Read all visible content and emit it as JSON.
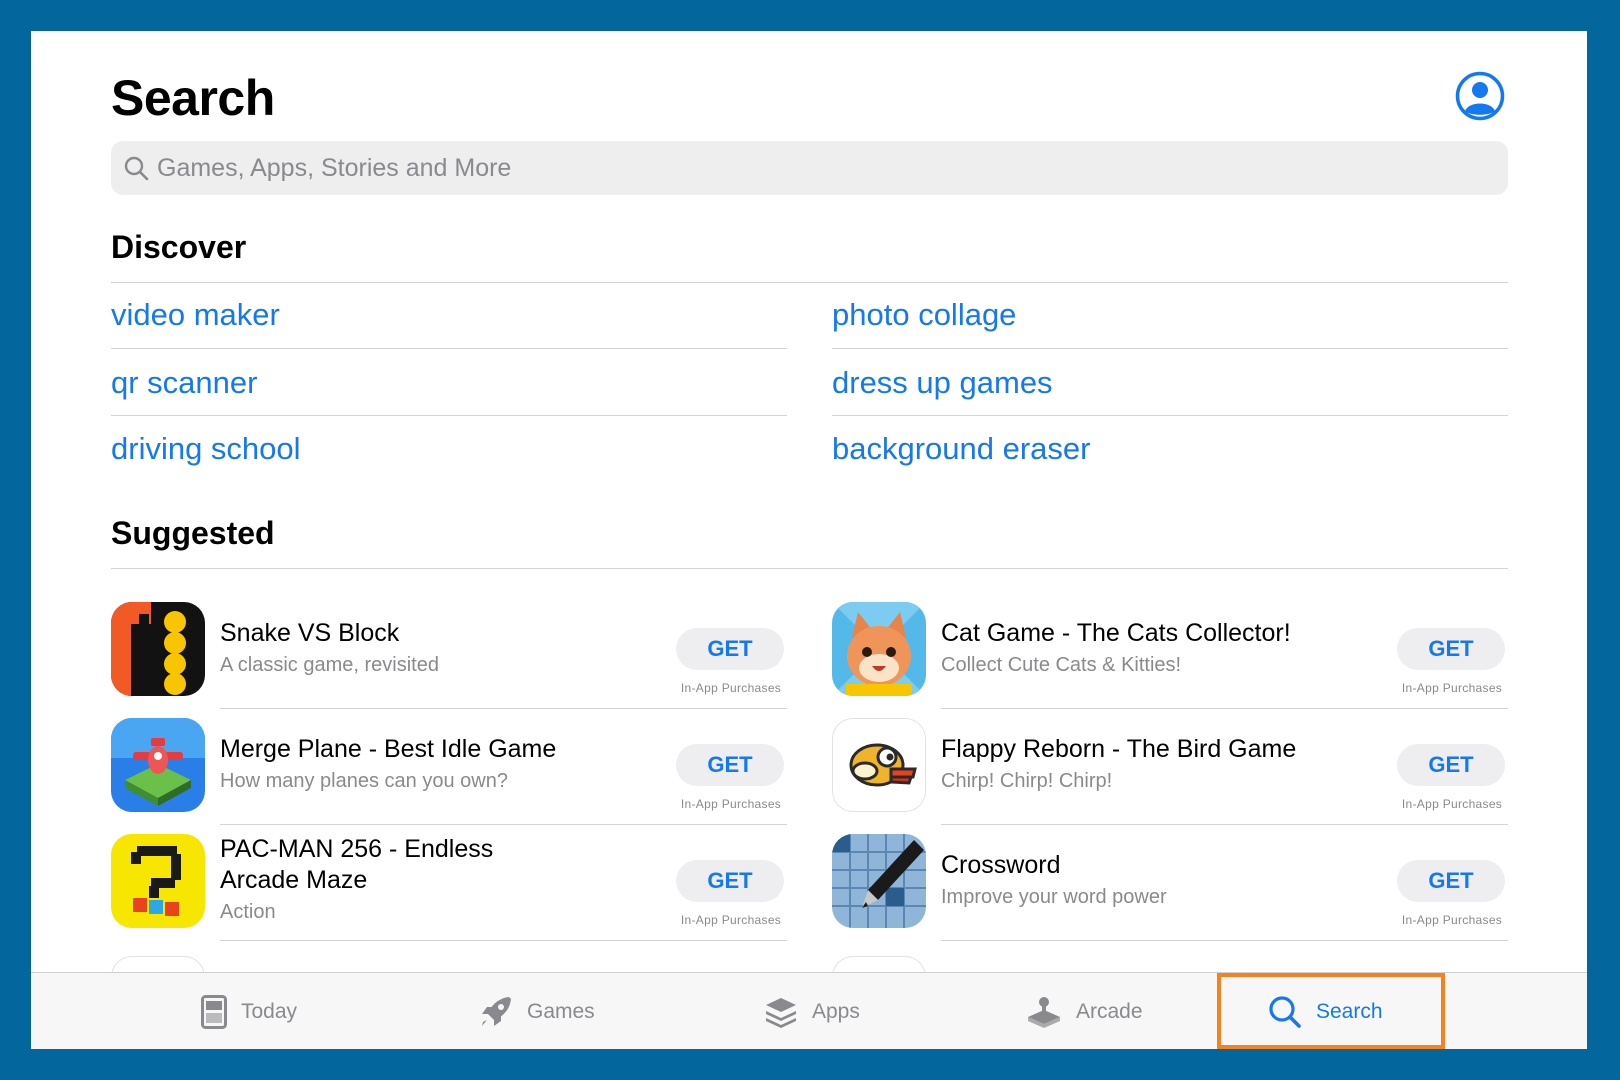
{
  "header": {
    "title": "Search"
  },
  "search": {
    "placeholder": "Games, Apps, Stories and More"
  },
  "discover": {
    "title": "Discover",
    "left": [
      "video maker",
      "qr scanner",
      "driving school"
    ],
    "right": [
      "photo collage",
      "dress up games",
      "background eraser"
    ]
  },
  "suggested": {
    "title": "Suggested",
    "apps": [
      {
        "name": "Snake VS Block",
        "subtitle": "A classic game, revisited",
        "button": "GET",
        "note": "In-App Purchases",
        "icon": "snake-vs-block-icon"
      },
      {
        "name": "Cat Game - The Cats Collector!",
        "subtitle": "Collect Cute Cats & Kitties!",
        "button": "GET",
        "note": "In-App Purchases",
        "icon": "cat-game-icon"
      },
      {
        "name": "Merge Plane - Best Idle Game",
        "subtitle": "How many planes can you own?",
        "button": "GET",
        "note": "In-App Purchases",
        "icon": "merge-plane-icon"
      },
      {
        "name": "Flappy Reborn - The Bird Game",
        "subtitle": "Chirp! Chirp! Chirp!",
        "button": "GET",
        "note": "In-App Purchases",
        "icon": "flappy-bird-icon"
      },
      {
        "name": "PAC-MAN 256 - Endless Arcade Maze",
        "subtitle": "Action",
        "button": "GET",
        "note": "In-App Purchases",
        "icon": "pac-man-256-icon"
      },
      {
        "name": "Crossword",
        "subtitle": "Improve your word power",
        "button": "GET",
        "note": "In-App Purchases",
        "icon": "crossword-pen-icon"
      }
    ]
  },
  "tabs": [
    {
      "label": "Today",
      "icon": "today-icon",
      "active": false
    },
    {
      "label": "Games",
      "icon": "rocket-icon",
      "active": false
    },
    {
      "label": "Apps",
      "icon": "stack-layers-icon",
      "active": false
    },
    {
      "label": "Arcade",
      "icon": "joystick-icon",
      "active": false
    },
    {
      "label": "Search",
      "icon": "search-icon",
      "active": true
    }
  ],
  "colors": {
    "frame": "#03679d",
    "accent": "#1478f0",
    "highlight": "#f5821f",
    "secondary_text": "#8a8a8e"
  }
}
